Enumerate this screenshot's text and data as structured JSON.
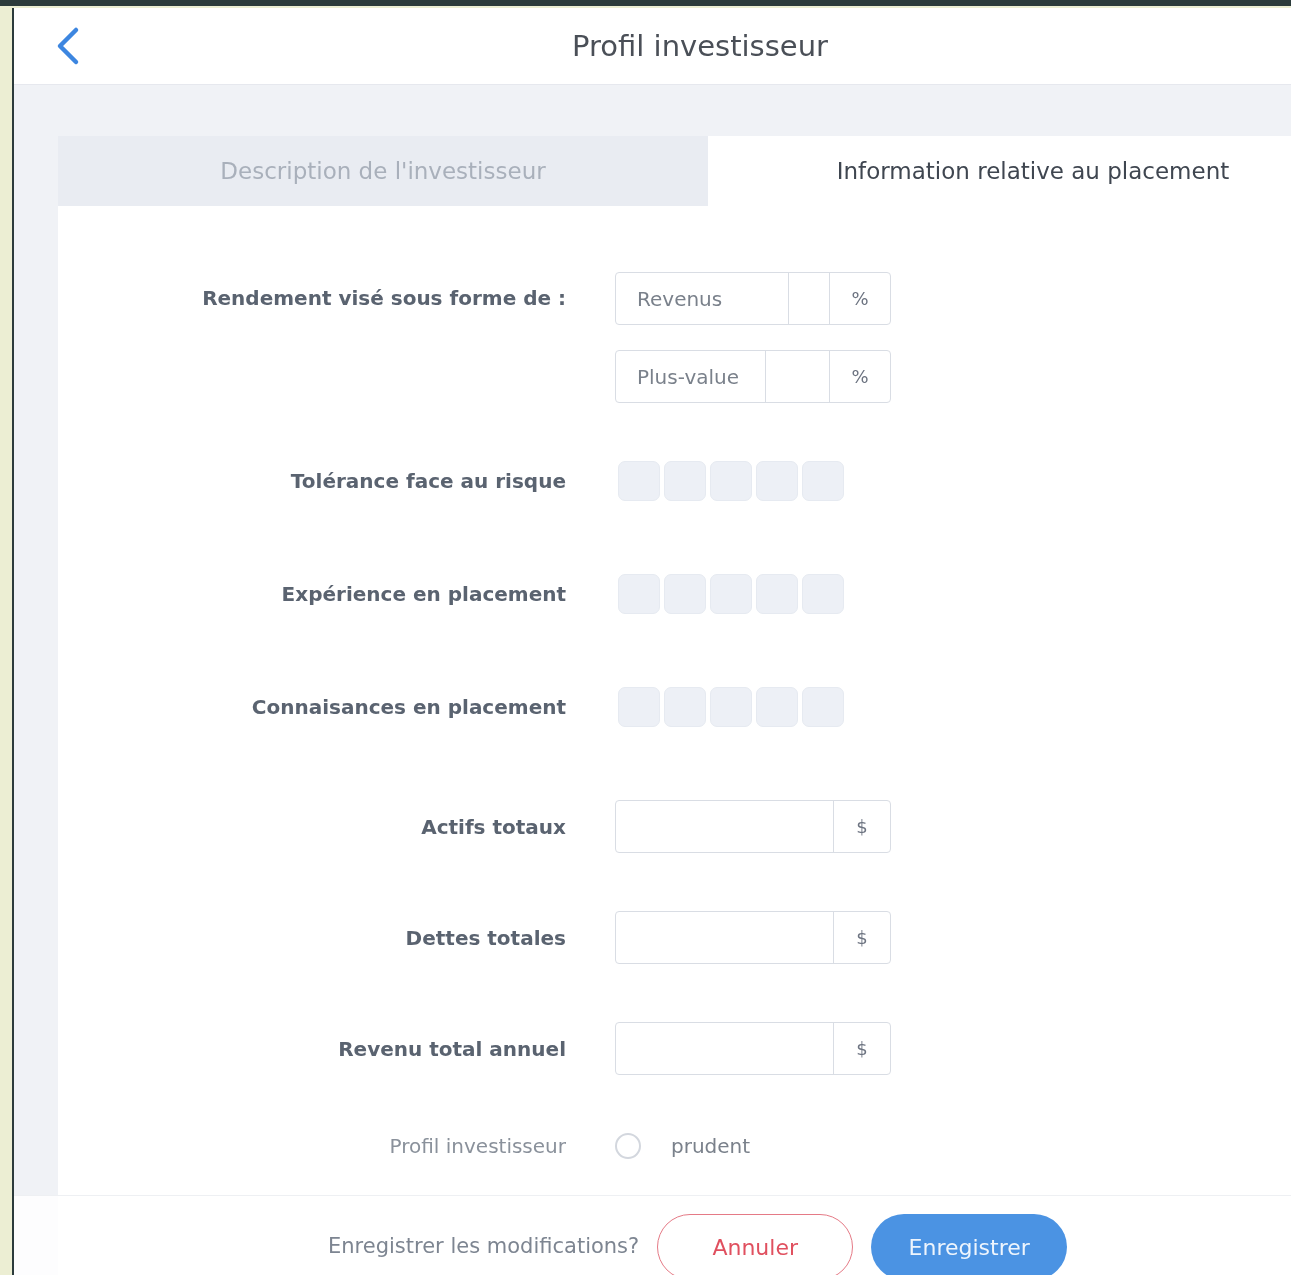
{
  "header": {
    "title": "Profil investisseur"
  },
  "tabs": [
    {
      "label": "Description de l'investisseur",
      "selected": false
    },
    {
      "label": "Information relative au placement",
      "selected": true
    }
  ],
  "form": [
    {
      "kind": "split",
      "label": "Rendement visé sous forme de :",
      "parts": [
        {
          "prefix": "Revenus",
          "unit": "%"
        },
        {
          "prefix": "Plus-value",
          "unit": "%"
        }
      ]
    },
    {
      "kind": "rating",
      "label": "Tolérance face au risque",
      "stars": 0
    },
    {
      "kind": "rating",
      "label": "Expérience en placement",
      "stars": 0
    },
    {
      "kind": "rating",
      "label": "Connaisances en placement",
      "stars": 0
    },
    {
      "kind": "amount",
      "label": "Actifs totaux",
      "unit": "$"
    },
    {
      "kind": "amount",
      "label": "Dettes totales",
      "unit": "$"
    },
    {
      "kind": "amount",
      "label": "Revenu total annuel",
      "unit": "$"
    },
    {
      "kind": "radio",
      "label": "Profil investisseur",
      "option": "prudent",
      "checked": false
    }
  ],
  "footer": {
    "prompt": "Enregistrer les modifications?",
    "cancel": "Annuler",
    "save": "Enregistrer"
  }
}
